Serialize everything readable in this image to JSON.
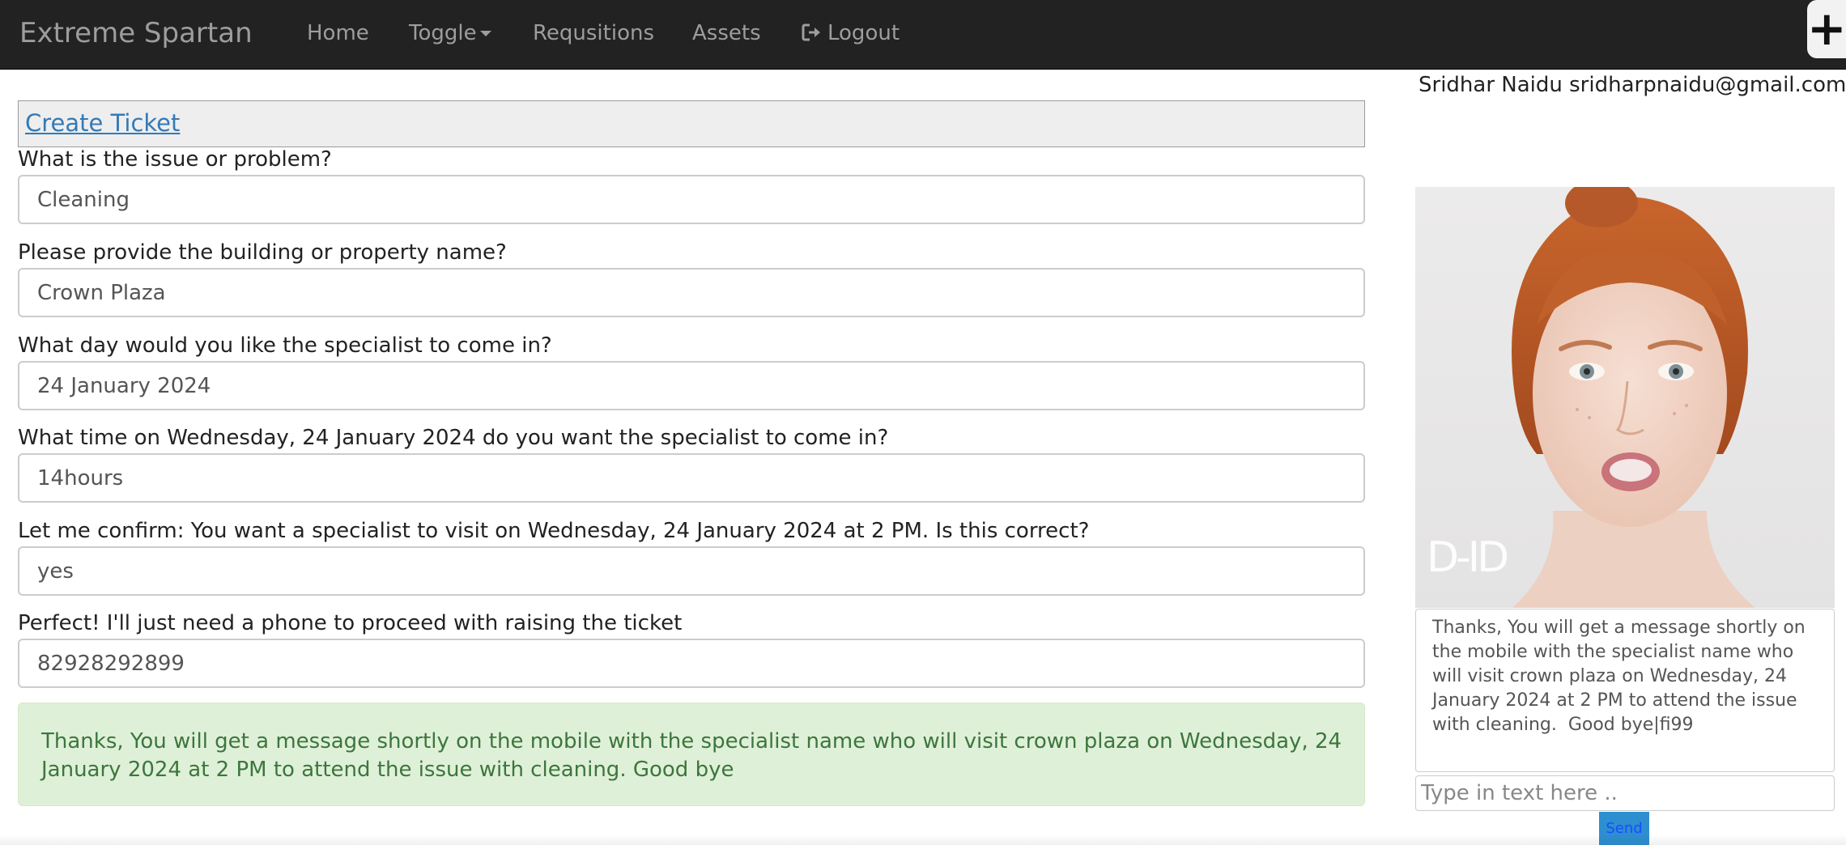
{
  "navbar": {
    "brand": "Extreme Spartan",
    "items": [
      {
        "label": "Home"
      },
      {
        "label": "Toggle"
      },
      {
        "label": "Requsitions"
      },
      {
        "label": "Assets"
      },
      {
        "label": "Logout"
      }
    ],
    "plus_label": "+"
  },
  "user": {
    "name": "Sridhar Naidu",
    "email": "sridharpnaidu@gmail.com",
    "display": "Sridhar Naidu sridharpnaidu@gmail.com"
  },
  "form": {
    "header_link": "Create Ticket",
    "questions": [
      {
        "label": "What is the issue or problem?",
        "value": "Cleaning"
      },
      {
        "label": "Please provide the building or property name?",
        "value": "Crown Plaza"
      },
      {
        "label": "What day would you like the specialist to come in?",
        "value": "24 January 2024"
      },
      {
        "label": "What time on Wednesday, 24 January 2024 do you want the specialist to come in?",
        "value": "14hours"
      },
      {
        "label": "Let me confirm: You want a specialist to visit on Wednesday, 24 January 2024 at 2 PM. Is this correct?",
        "value": "yes"
      },
      {
        "label": "Perfect! I'll just need a phone to proceed with raising the ticket",
        "value": "82928292899"
      }
    ],
    "success_message": "Thanks, You will get a message shortly on the mobile with the specialist name who will visit crown plaza on Wednesday, 24 January 2024 at 2 PM to attend the issue with cleaning. Good bye"
  },
  "assistant": {
    "watermark": "D-ID",
    "output_text": "Thanks, You will get a message shortly on the mobile with the specialist name who will visit crown plaza on Wednesday, 24 January 2024 at 2 PM to attend the issue with cleaning.  Good bye|fi99",
    "input_placeholder": "Type in text here ..",
    "send_label": "Send"
  },
  "colors": {
    "navbar_bg": "#222222",
    "nav_text": "#9d9d9d",
    "link": "#337ab7",
    "success_bg": "#dff0d8",
    "success_text": "#3c763d",
    "send_bg": "#2d8fd0"
  }
}
